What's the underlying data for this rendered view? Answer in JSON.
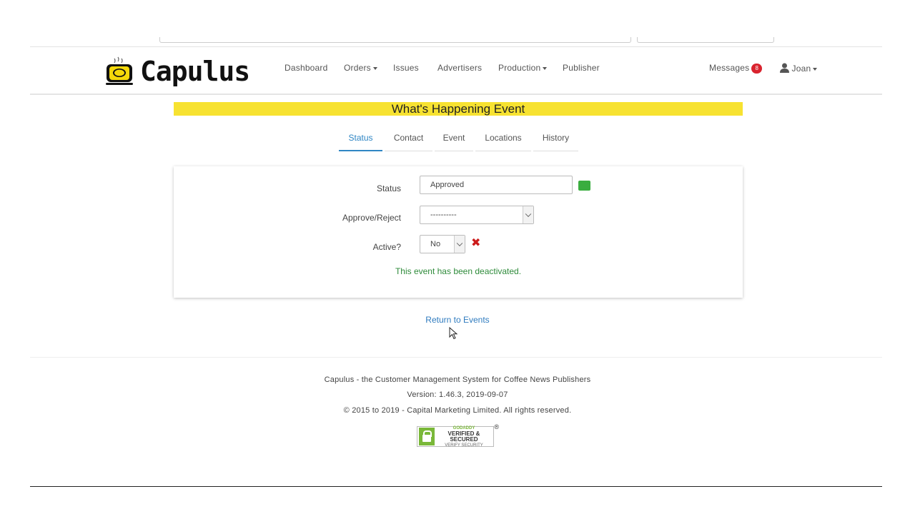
{
  "navbar": {
    "brand": "Capulus",
    "items": [
      {
        "label": "Dashboard",
        "dropdown": false
      },
      {
        "label": "Orders",
        "dropdown": true
      },
      {
        "label": "Issues",
        "dropdown": false
      },
      {
        "label": "Advertisers",
        "dropdown": false
      },
      {
        "label": "Production",
        "dropdown": true
      },
      {
        "label": "Publisher",
        "dropdown": false
      }
    ],
    "messages_label": "Messages",
    "messages_count": "8",
    "user_name": "Joan"
  },
  "page": {
    "title": "What's Happening Event",
    "title_bg": "#f7e231",
    "tabs": [
      {
        "label": "Status",
        "active": true
      },
      {
        "label": "Contact",
        "active": false
      },
      {
        "label": "Event",
        "active": false
      },
      {
        "label": "Locations",
        "active": false
      },
      {
        "label": "History",
        "active": false
      }
    ]
  },
  "form": {
    "status_label": "Status",
    "status_value": "Approved",
    "status_color": "#3aad3f",
    "approve_label": "Approve/Reject",
    "approve_value": "----------",
    "active_label": "Active?",
    "active_value": "No",
    "deactivated_message": "This event has been deactivated."
  },
  "return_link": "Return to Events",
  "footer": {
    "line1": "Capulus - the Customer Management System for Coffee News Publishers",
    "line2": "Version: 1.46.3, 2019-09-07",
    "line3": "© 2015 to 2019 - Capital Marketing Limited. All rights reserved.",
    "seal_line1": "GODADDY",
    "seal_line2": "VERIFIED & SECURED",
    "seal_line3": "VERIFY SECURITY",
    "seal_reg": "®"
  }
}
